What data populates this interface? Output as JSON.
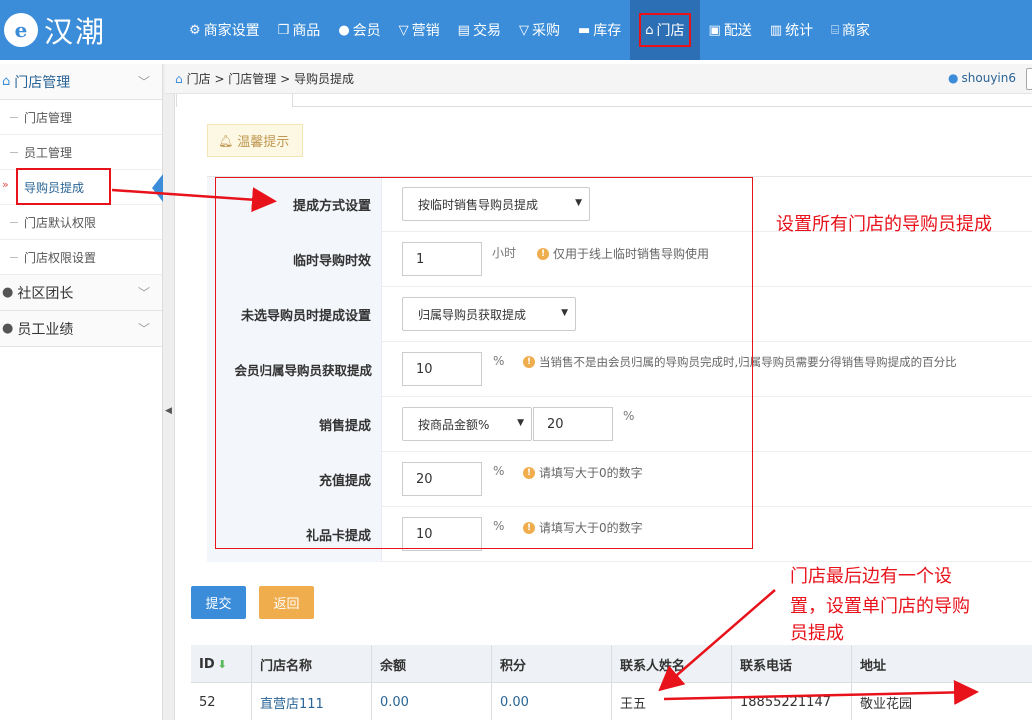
{
  "brand": {
    "logo_mark": "e",
    "name": "汉潮"
  },
  "nav": [
    {
      "icon": "gear-icon",
      "glyph": "⚙",
      "label": "商家设置"
    },
    {
      "icon": "cube-icon",
      "glyph": "❒",
      "label": "商品"
    },
    {
      "icon": "user-icon",
      "glyph": "●",
      "label": "会员"
    },
    {
      "icon": "megaphone-icon",
      "glyph": "▽",
      "label": "营销"
    },
    {
      "icon": "receipt-icon",
      "glyph": "▤",
      "label": "交易"
    },
    {
      "icon": "cart-icon",
      "glyph": "▽",
      "label": "采购"
    },
    {
      "icon": "warehouse-icon",
      "glyph": "▬",
      "label": "库存"
    },
    {
      "icon": "home-icon",
      "glyph": "⌂",
      "label": "门店"
    },
    {
      "icon": "truck-icon",
      "glyph": "▣",
      "label": "配送"
    },
    {
      "icon": "bar-chart-icon",
      "glyph": "▥",
      "label": "统计"
    },
    {
      "icon": "store-icon",
      "glyph": "⌸",
      "label": "商家"
    }
  ],
  "sidebar": {
    "section_store": "门店管理",
    "items": [
      "门店管理",
      "员工管理",
      "导购员提成",
      "门店默认权限",
      "门店权限设置"
    ],
    "section_community": "社区团长",
    "section_staff": "员工业绩"
  },
  "breadcrumb": "门店 > 门店管理 > 导购员提成",
  "user": "shouyin6",
  "tip": "温馨提示",
  "form": {
    "method_label": "提成方式设置",
    "method_value": "按临时销售导购员提成",
    "temp_label": "临时导购时效",
    "temp_value": "1",
    "temp_unit": "小时",
    "temp_hint": "仅用于线上临时销售导购使用",
    "unselected_label": "未选导购员时提成设置",
    "unselected_value": "归属导购员获取提成",
    "member_label": "会员归属导购员获取提成",
    "member_value": "10",
    "member_unit": "%",
    "member_hint": "当销售不是由会员归属的导购员完成时,归属导购员需要分得销售导购提成的百分比",
    "sales_label": "销售提成",
    "sales_mode": "按商品金额%",
    "sales_value": "20",
    "sales_unit": "%",
    "recharge_label": "充值提成",
    "recharge_value": "20",
    "recharge_unit": "%",
    "recharge_hint": "请填写大于0的数字",
    "gift_label": "礼品卡提成",
    "gift_value": "10",
    "gift_unit": "%",
    "gift_hint": "请填写大于0的数字"
  },
  "buttons": {
    "submit": "提交",
    "back": "返回"
  },
  "table": {
    "headers": [
      "ID",
      "门店名称",
      "余额",
      "积分",
      "联系人姓名",
      "联系电话",
      "地址"
    ],
    "rows": [
      [
        "52",
        "直营店111",
        "0.00",
        "0.00",
        "王五",
        "18855221147",
        "敬业花园"
      ]
    ]
  },
  "annotations": {
    "right_note": "设置所有门店的导购员提成",
    "bottom_note_1": "门店最后边有一个设",
    "bottom_note_2": "置，设置单门店的导购",
    "bottom_note_3": "员提成"
  },
  "colors": {
    "header": "#3c8dd9",
    "annotation": "#e8121b",
    "warning": "#f0ad4e"
  }
}
